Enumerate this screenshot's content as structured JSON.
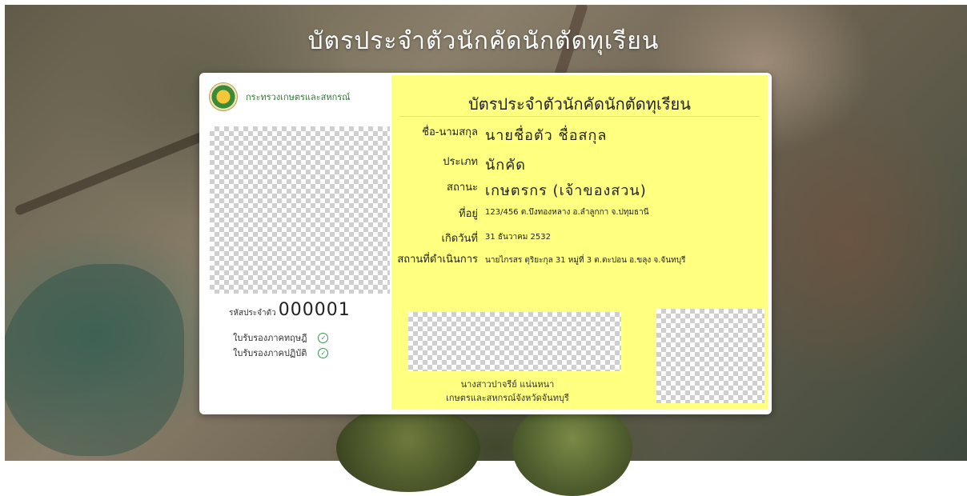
{
  "page": {
    "title": "บัตรประจำตัวนักคัดนักตัดทุเรียน"
  },
  "card": {
    "ministry": "กระทรวงเกษตรและสหกรณ์",
    "emblem_icon": "ministry-emblem-icon",
    "title": "บัตรประจำตัวนักคัดนักตัดทุเรียน",
    "id_label": "รหัสประจำตัว",
    "id_number": "000001",
    "certificates": [
      {
        "label": "ใบรับรองภาคทฤษฎี",
        "icon": "check-circle-icon",
        "status_color": "#2e9e4a"
      },
      {
        "label": "ใบรับรองภาคปฏิบัติ",
        "icon": "check-circle-icon",
        "status_color": "#2e9e4a"
      }
    ],
    "fields": [
      {
        "label": "ชื่อ-นามสกุล",
        "value": "นายชื่อตัว ชื่อสกุล"
      },
      {
        "label": "ประเภท",
        "value": "นักคัด"
      },
      {
        "label": "สถานะ",
        "value": "เกษตรกร (เจ้าของสวน)"
      },
      {
        "label": "ที่อยู่",
        "value": "123/456 ต.บึงทองหลาง อ.ลำลูกกา จ.ปทุมธานี"
      },
      {
        "label": "เกิดวันที่",
        "value": "31 ธันวาคม 2532"
      },
      {
        "label": "สถานที่ดำเนินการ",
        "value": "นายไกรสร ตุริยะกุล 31 หมู่ที่ 3 ต.ตะปอน อ.ขลุง จ.จันทบุรี"
      }
    ],
    "signer_name": "นางสาวปาจรีย์ แน่นหนา",
    "signer_position": "เกษตรและสหกรณ์จังหวัดจันทบุรี",
    "accent_color": "#ffff80",
    "ministry_color": "#2e7d32"
  }
}
